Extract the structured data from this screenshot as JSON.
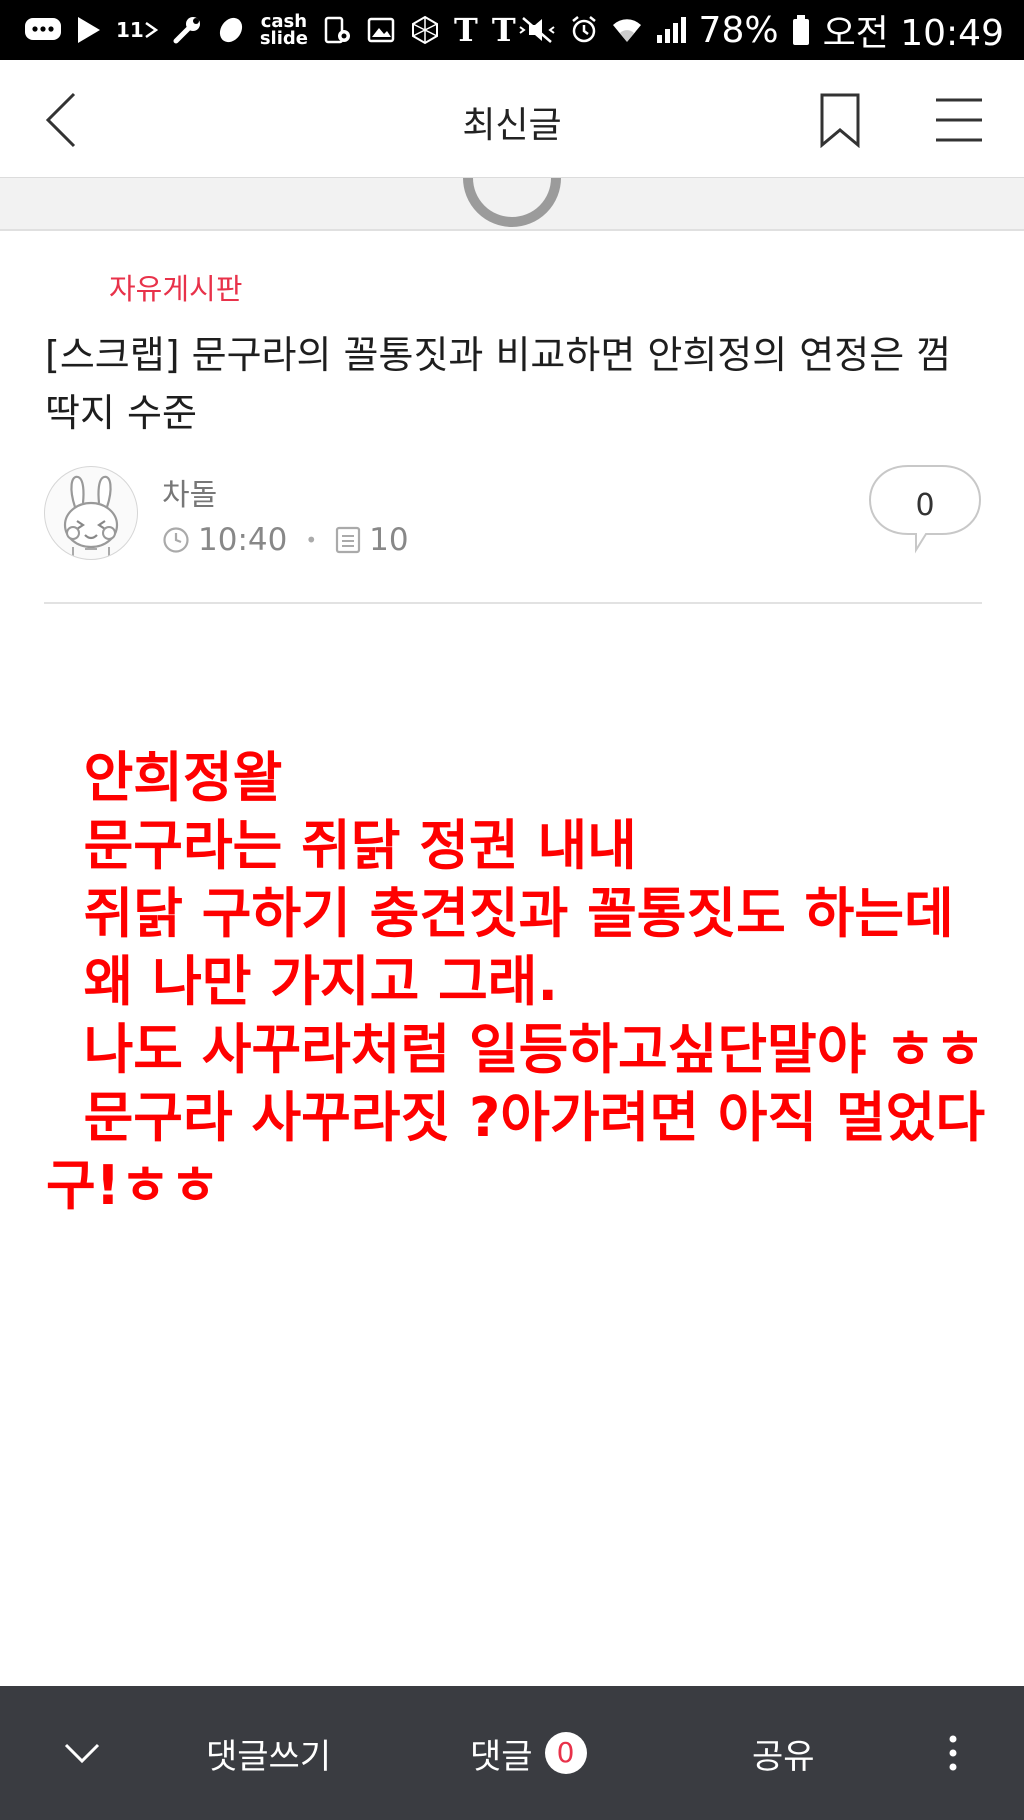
{
  "status_bar": {
    "icons_left": [
      "message-icon",
      "play-icon",
      "11st-icon",
      "wrench-icon",
      "bean-icon",
      "cashslide-icon",
      "screenshot-icon",
      "gallery-icon",
      "cube-icon",
      "nyt-icon",
      "nyt-icon"
    ],
    "app_11st": "11",
    "cashslide_line1": "cash",
    "cashslide_line2": "slide",
    "nyt_letter": "T",
    "battery": "78%",
    "time": "오전 10:49"
  },
  "app_bar": {
    "title": "최신글"
  },
  "post": {
    "board": "자유게시판",
    "title": "[스크랩] 문구라의 꼴통짓과 비교하면 안희정의 연정은 껌딱지 수준",
    "author": "차돌",
    "time": "10:40",
    "views": "10",
    "comment_count": "0",
    "body": "  안희정왈\n  문구라는 쥐닭 정권 내내\n  쥐닭 구하기 충견짓과 꼴통짓도 하는데\n  왜 나만 가지고 그래.\n  나도 사꾸라처럼 일등하고싶단말야 ㅎㅎ\n  문구라 사꾸라짓 ?아가려면 아직 멀었다구!ㅎㅎ"
  },
  "bottom_bar": {
    "write_comment": "댓글쓰기",
    "comments": "댓글",
    "comments_count": "0",
    "share": "공유"
  },
  "colors": {
    "accent_red": "#e8324a",
    "body_text_red": "#ff0000",
    "bottom_bar_bg": "#3a3c41"
  }
}
